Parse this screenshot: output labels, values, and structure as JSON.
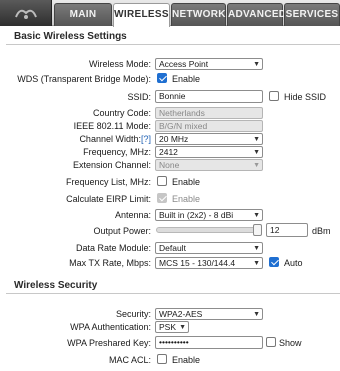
{
  "tabs": [
    {
      "label": "MAIN"
    },
    {
      "label": "WIRELESS"
    },
    {
      "label": "NETWORK"
    },
    {
      "label": "ADVANCED"
    },
    {
      "label": "SERVICES"
    }
  ],
  "active_tab": "WIRELESS",
  "basic": {
    "title": "Basic Wireless Settings",
    "wireless_mode": {
      "label": "Wireless Mode:",
      "value": "Access Point"
    },
    "wds": {
      "label": "WDS (Transparent Bridge Mode):",
      "checkbox_label": "Enable",
      "checked": true
    },
    "ssid": {
      "label": "SSID:",
      "value": "Bonnie",
      "hide_label": "Hide SSID",
      "hide_checked": false
    },
    "country": {
      "label": "Country Code:",
      "value": "Netherlands"
    },
    "ieee": {
      "label": "IEEE 802.11 Mode:",
      "value": "B/G/N mixed"
    },
    "channel_width": {
      "label": "Channel Width:",
      "help": "[?]",
      "value": "20 MHz"
    },
    "frequency": {
      "label": "Frequency, MHz:",
      "value": "2412"
    },
    "extension": {
      "label": "Extension Channel:",
      "value": "None"
    },
    "freq_list": {
      "label": "Frequency List, MHz:",
      "checkbox_label": "Enable",
      "checked": false
    },
    "eirp": {
      "label": "Calculate EIRP Limit:",
      "checkbox_label": "Enable",
      "checked": true
    },
    "antenna": {
      "label": "Antenna:",
      "value": "Built in (2x2) - 8 dBi"
    },
    "output_power": {
      "label": "Output Power:",
      "value": "12",
      "unit": "dBm",
      "level": 1.0
    },
    "data_rate": {
      "label": "Data Rate Module:",
      "value": "Default"
    },
    "max_tx": {
      "label": "Max TX Rate, Mbps:",
      "value": "MCS 15 - 130/144.4",
      "auto_label": "Auto",
      "auto_checked": true
    }
  },
  "security": {
    "title": "Wireless Security",
    "security": {
      "label": "Security:",
      "value": "WPA2-AES"
    },
    "wpa_auth": {
      "label": "WPA Authentication:",
      "value": "PSK"
    },
    "wpa_key": {
      "label": "WPA Preshared Key:",
      "value": "••••••••••",
      "show_label": "Show",
      "show_checked": false
    },
    "mac_acl": {
      "label": "MAC ACL:",
      "checkbox_label": "Enable",
      "checked": false
    }
  }
}
